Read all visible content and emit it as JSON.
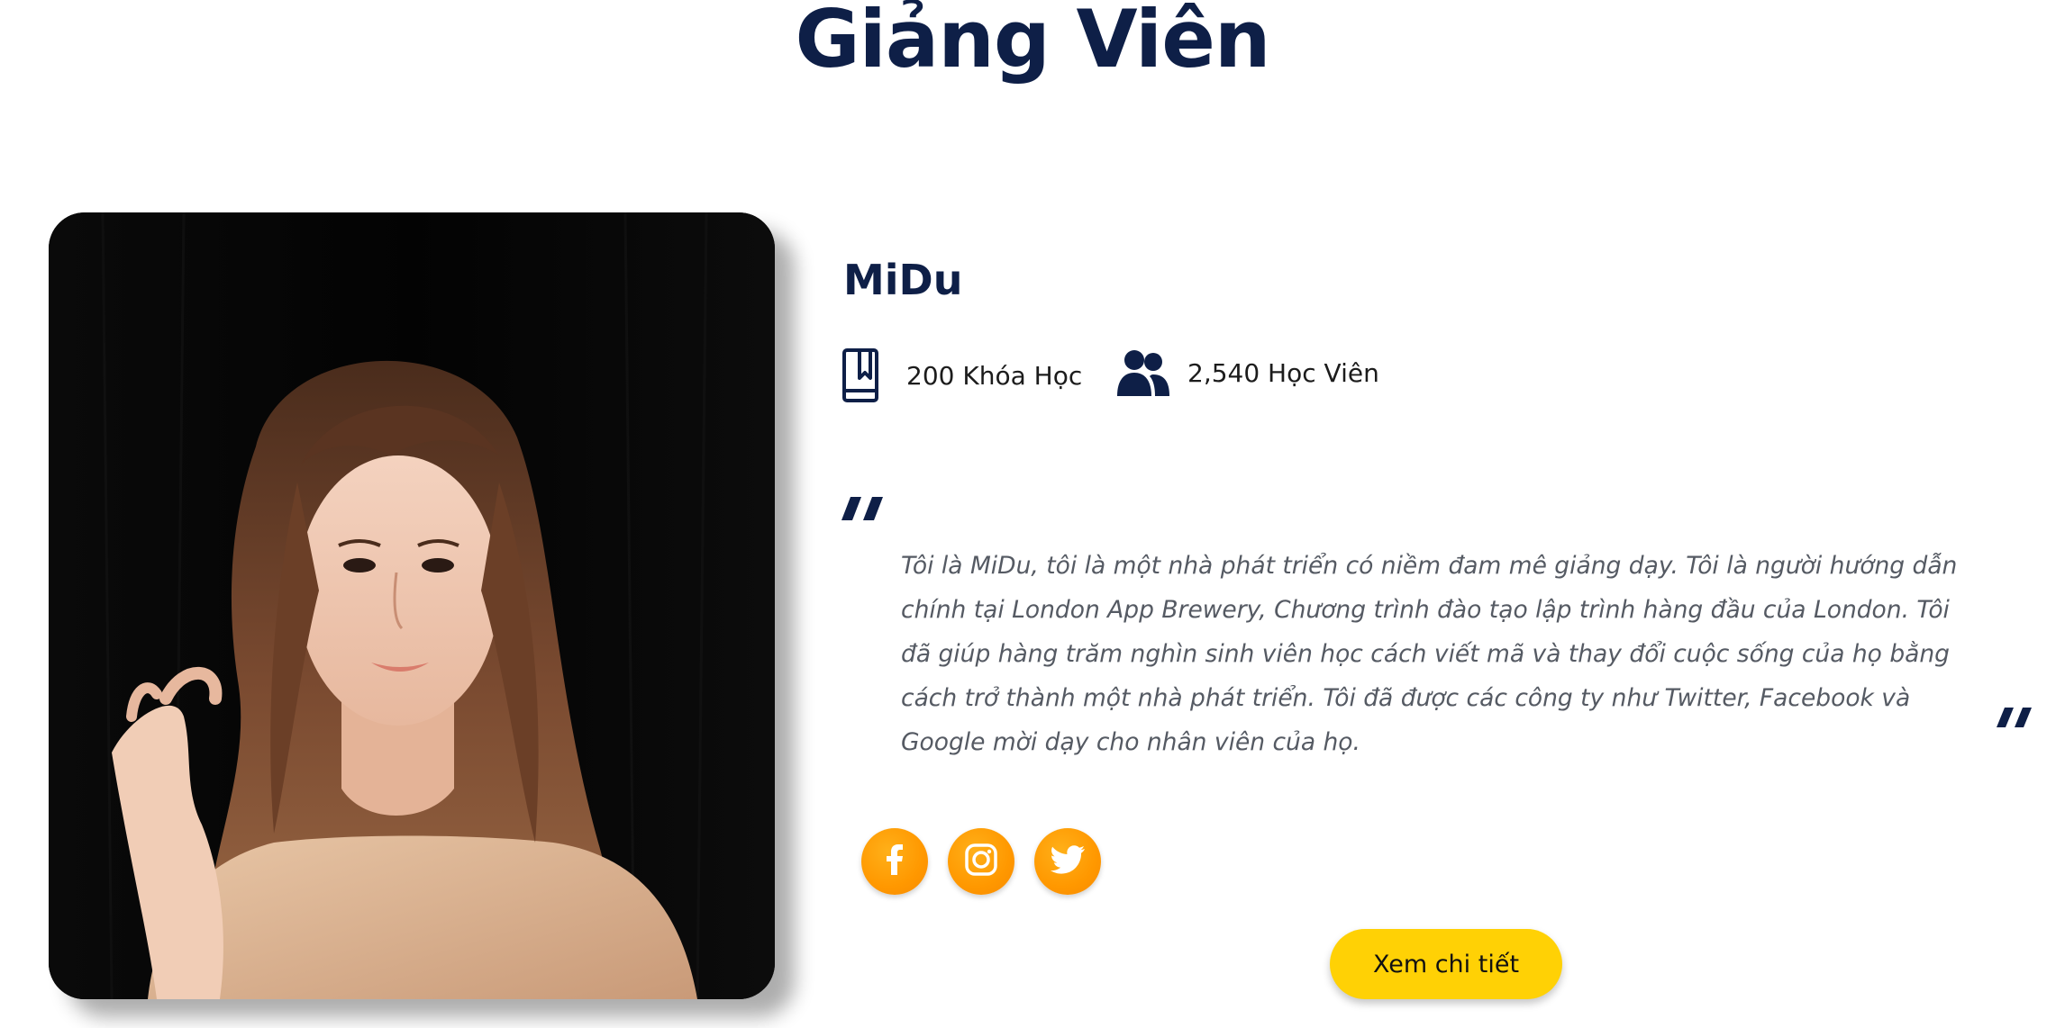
{
  "section": {
    "title": "Giảng Viên"
  },
  "instructor": {
    "name": "MiDu",
    "courses": "200 Khóa Học",
    "students": "2,540 Học Viên",
    "bio": "Tôi là MiDu, tôi là một nhà phát triển có niềm đam mê giảng dạy. Tôi là người hướng dẫn chính tại London App Brewery, Chương trình đào tạo lập trình hàng đầu của London. Tôi đã giúp hàng trăm nghìn sinh viên học cách viết mã và thay đổi cuộc sống của họ bằng cách trở thành một nhà phát triển. Tôi đã được các công ty như Twitter, Facebook và Google mời dạy cho nhân viên của họ.",
    "photo_icon": "portrait-photo"
  },
  "socials": [
    {
      "icon": "facebook-icon"
    },
    {
      "icon": "instagram-icon"
    },
    {
      "icon": "twitter-icon"
    }
  ],
  "actions": {
    "detail_label": "Xem chi tiết"
  },
  "colors": {
    "heading": "#0e1f47",
    "social_orange": "#ff9800",
    "button_yellow": "#ffd105",
    "quote_text": "#555a63"
  }
}
